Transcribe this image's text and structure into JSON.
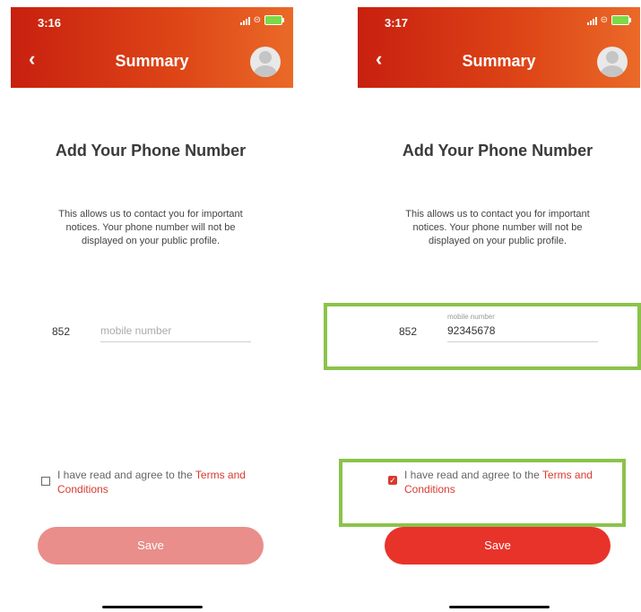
{
  "screens": [
    {
      "status_time": "3:16",
      "header_title": "Summary",
      "page_title": "Add Your Phone Number",
      "description": "This allows us to contact you for important notices. Your phone number will not be displayed on your public profile.",
      "country_code": "852",
      "mobile_placeholder": "mobile number",
      "mobile_value": "",
      "terms_prefix": "I have read and agree to the ",
      "terms_link": "Terms and Conditions",
      "terms_checked": false,
      "save_label": "Save",
      "save_enabled": false
    },
    {
      "status_time": "3:17",
      "header_title": "Summary",
      "page_title": "Add Your Phone Number",
      "description": "This allows us to contact you for important notices. Your phone number will not be displayed on your public profile.",
      "country_code": "852",
      "mobile_label": "mobile number",
      "mobile_value": "92345678",
      "terms_prefix": "I have read and agree to the ",
      "terms_link": "Terms and Conditions",
      "terms_checked": true,
      "save_label": "Save",
      "save_enabled": true
    }
  ],
  "icons": {
    "back": "chevron-left-icon",
    "avatar": "user-avatar-icon",
    "checkbox": "checkbox-icon"
  },
  "colors": {
    "header_gradient_start": "#c8200f",
    "header_gradient_end": "#ea6a28",
    "accent": "#d83a2e",
    "save_enabled": "#e8332a",
    "save_disabled": "#e98e8a",
    "highlight": "#8bc34a"
  }
}
